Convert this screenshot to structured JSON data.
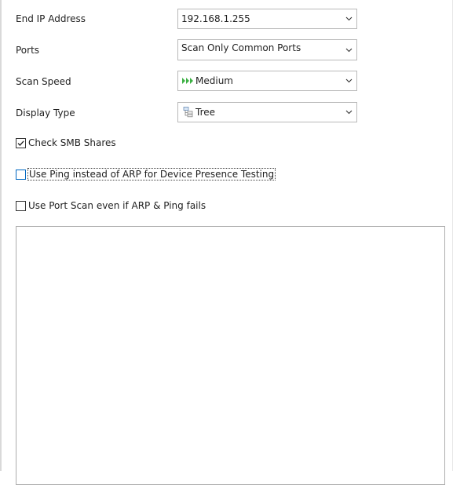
{
  "fields": [
    {
      "label": "End IP Address",
      "value": "192.168.1.255",
      "icon": ""
    },
    {
      "label": "Ports",
      "value": "Scan Only Common Ports",
      "icon": ""
    },
    {
      "label": "Scan Speed",
      "value": "Medium",
      "icon": "speed-arrows-icon"
    },
    {
      "label": "Display Type",
      "value": "Tree",
      "icon": "tree-view-icon"
    }
  ],
  "options": [
    {
      "label": "Check SMB Shares",
      "checked": true,
      "focused": false
    },
    {
      "label": "Use Ping instead of ARP for Device Presence Testing",
      "checked": false,
      "focused": true
    },
    {
      "label": "Use Port Scan even if ARP & Ping fails",
      "checked": false,
      "focused": false
    }
  ],
  "colors": {
    "speed_icon": "#3cb043",
    "focus_border": "#0067c0"
  }
}
